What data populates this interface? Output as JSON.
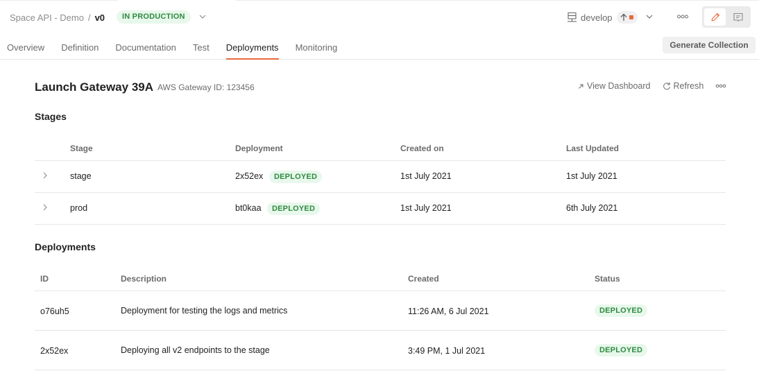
{
  "header": {
    "breadcrumb": {
      "parent": "Space API - Demo",
      "separator": "/",
      "version": "v0"
    },
    "environment_badge": "IN PRODUCTION",
    "tabs": [
      {
        "label": "Overview",
        "active": false
      },
      {
        "label": "Definition",
        "active": false
      },
      {
        "label": "Documentation",
        "active": false
      },
      {
        "label": "Test",
        "active": false
      },
      {
        "label": "Deployments",
        "active": true
      },
      {
        "label": "Monitoring",
        "active": false
      }
    ],
    "branch": {
      "name": "develop",
      "has_unpushed_changes": true
    },
    "generate_collection_label": "Generate Collection",
    "mode": "edit"
  },
  "gateway": {
    "title": "Launch Gateway 39A",
    "subtitle": "AWS Gateway ID: 123456",
    "actions": {
      "view_dashboard": "View Dashboard",
      "refresh": "Refresh"
    }
  },
  "stages": {
    "title": "Stages",
    "columns": [
      "Stage",
      "Deployment",
      "Created on",
      "Last Updated"
    ],
    "rows": [
      {
        "stage": "stage",
        "deployment": "2x52ex",
        "status": "DEPLOYED",
        "created_on": "1st July 2021",
        "last_updated": "1st July 2021"
      },
      {
        "stage": "prod",
        "deployment": "bt0kaa",
        "status": "DEPLOYED",
        "created_on": "1st July 2021",
        "last_updated": "6th July 2021"
      }
    ]
  },
  "deployments": {
    "title": "Deployments",
    "columns": [
      "ID",
      "Description",
      "Created",
      "Status"
    ],
    "rows": [
      {
        "id": "o76uh5",
        "description": "Deployment for testing the logs and metrics",
        "created": "11:26 AM, 6 Jul 2021",
        "status": "DEPLOYED"
      },
      {
        "id": "2x52ex",
        "description": "Deploying all v2 endpoints to the stage",
        "created": "3:49 PM, 1 Jul 2021",
        "status": "DEPLOYED"
      }
    ]
  },
  "colors": {
    "accent": "#e8693c",
    "badge_bg": "#e8f8ec",
    "badge_text": "#2e8a40",
    "muted_text": "#6b6b6b",
    "divider": "#e6e6e6"
  }
}
